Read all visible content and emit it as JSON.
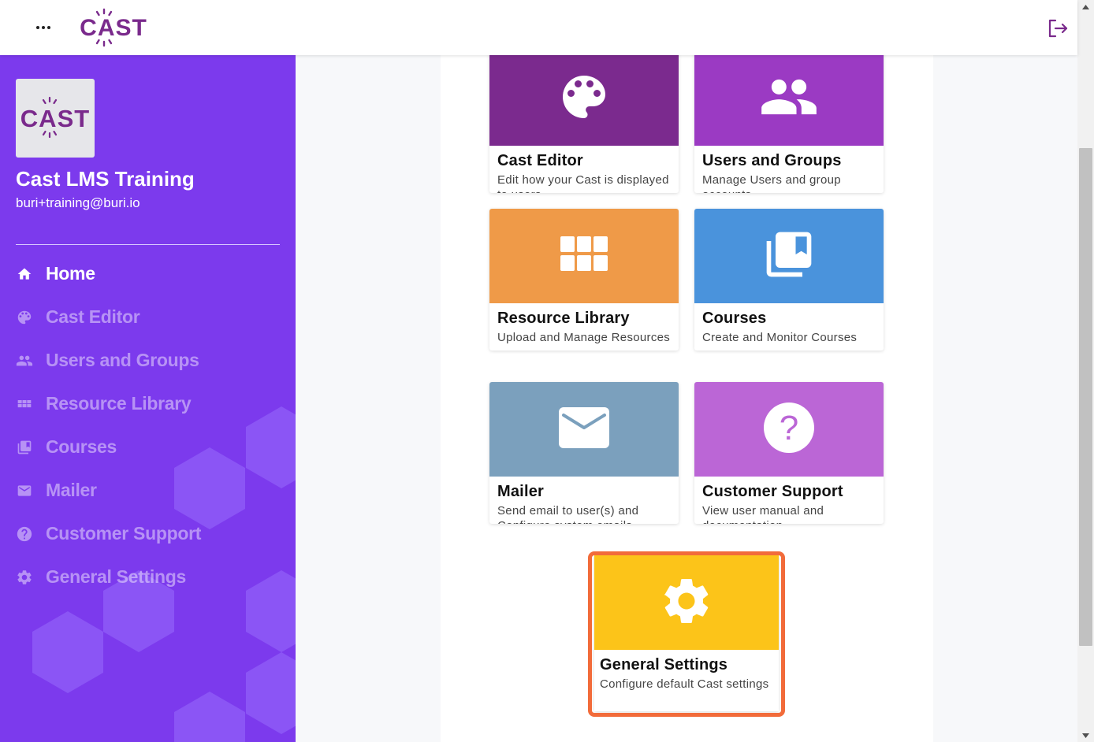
{
  "header": {
    "menu_icon": "more-horizontal-icon",
    "logo_text": "CAST",
    "logout_icon": "logout-icon"
  },
  "sidebar": {
    "org_name": "Cast LMS Training",
    "email": "buri+training@buri.io",
    "logo_text": "CAST",
    "items": [
      {
        "label": "Home",
        "icon": "home-icon",
        "active": true
      },
      {
        "label": "Cast Editor",
        "icon": "palette-icon",
        "active": false
      },
      {
        "label": "Users and Groups",
        "icon": "users-icon",
        "active": false
      },
      {
        "label": "Resource Library",
        "icon": "grid-icon",
        "active": false
      },
      {
        "label": "Courses",
        "icon": "library-books-icon",
        "active": false
      },
      {
        "label": "Mailer",
        "icon": "mail-icon",
        "active": false
      },
      {
        "label": "Customer Support",
        "icon": "help-circle-icon",
        "active": false
      },
      {
        "label": "General Settings",
        "icon": "gear-icon",
        "active": false
      }
    ]
  },
  "cards": [
    {
      "title": "Cast Editor",
      "description": "Edit how your Cast is displayed to users",
      "color": "#7b2a8e",
      "icon": "palette-icon"
    },
    {
      "title": "Users and Groups",
      "description": "Manage Users and group accounts",
      "color": "#9b3ac3",
      "icon": "users-icon"
    },
    {
      "title": "Resource Library",
      "description": "Upload and Manage Resources",
      "color": "#ef9a48",
      "icon": "grid-icon"
    },
    {
      "title": "Courses",
      "description": "Create and Monitor Courses",
      "color": "#4a93dc",
      "icon": "library-books-icon"
    },
    {
      "title": "Mailer",
      "description": "Send email to user(s) and Configure system emails",
      "color": "#7ba0bd",
      "icon": "mail-icon"
    },
    {
      "title": "Customer Support",
      "description": "View user manual and documentation",
      "color": "#bb66d6",
      "icon": "help-circle-icon"
    },
    {
      "title": "General Settings",
      "description": "Configure default Cast settings",
      "color": "#fcc419",
      "icon": "gear-icon"
    }
  ],
  "colors": {
    "sidebar_bg": "#7c3aed",
    "brand_purple": "#7a2a8c",
    "highlight": "#f26b3a"
  }
}
